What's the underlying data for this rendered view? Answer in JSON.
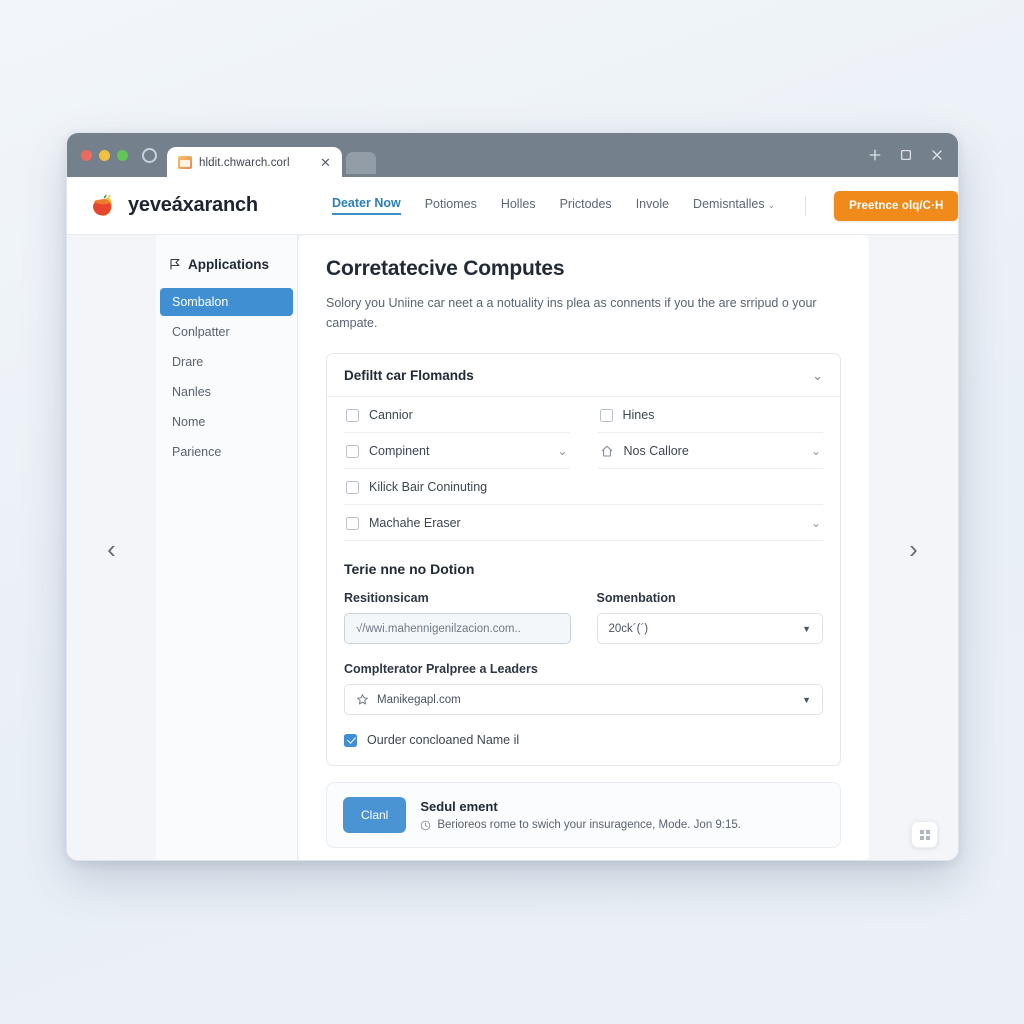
{
  "browser": {
    "tab": {
      "title": "hldit.chwarch.corl",
      "favicon": "site-favicon",
      "close": "✕"
    },
    "new_tab": "+",
    "window_controls": {
      "minimize": "+",
      "maximize": "□",
      "close": "✕"
    }
  },
  "header": {
    "brand": "yeveáxaranch",
    "logo": "fruit-logo",
    "nav": [
      {
        "label": "Deater Now",
        "active": true,
        "caret": ""
      },
      {
        "label": "Potiomes",
        "active": false,
        "caret": ""
      },
      {
        "label": "Holles",
        "active": false,
        "caret": ""
      },
      {
        "label": "Prictodes",
        "active": false,
        "caret": ""
      },
      {
        "label": "Invole",
        "active": false,
        "caret": ""
      },
      {
        "label": "Demisntalles",
        "active": false,
        "caret": "⌄"
      }
    ],
    "cta": "Preetnce olq/C·H"
  },
  "rails": {
    "prev": "‹",
    "next": "›"
  },
  "sidebar": {
    "heading": "Applications",
    "heading_icon": "flag-icon",
    "items": [
      {
        "label": "Sombalon",
        "active": true
      },
      {
        "label": "Conlpatter",
        "active": false
      },
      {
        "label": "Drare",
        "active": false
      },
      {
        "label": "Nanles",
        "active": false
      },
      {
        "label": "Nome",
        "active": false
      },
      {
        "label": "Parience",
        "active": false
      }
    ]
  },
  "main": {
    "title": "Corretatecive Computes",
    "description": "Solory you Uniine car neet a a notuality ins plea as connents if you the are srripud o your campate.",
    "panel": {
      "title": "Defiltt car Flomands",
      "collapse_caret": "⌄",
      "checkboxes": [
        {
          "label": "Cannior",
          "checked": false,
          "icon": "",
          "tail": "",
          "span": false
        },
        {
          "label": "Hines",
          "checked": false,
          "icon": "",
          "tail": "",
          "span": false
        },
        {
          "label": "Compinent",
          "checked": false,
          "icon": "",
          "tail": "⌄",
          "span": false
        },
        {
          "label": "Nos Callore",
          "checked": false,
          "icon": "home-icon",
          "tail": "⌄",
          "span": false
        },
        {
          "label": "Kilick Bair Coninuting",
          "checked": false,
          "icon": "",
          "tail": "",
          "span": true
        },
        {
          "label": "Machahe Eraser",
          "checked": false,
          "icon": "",
          "tail": "⌄",
          "span": true
        }
      ],
      "section_title": "Terie nne no Dotion",
      "fields": [
        {
          "label": "Resitionsicam",
          "value": "√/wwi.mahennigenilzacion.com..",
          "type": "input"
        },
        {
          "label": "Somenbation",
          "value": "20ck´(´)",
          "type": "select",
          "caret": "▼"
        }
      ],
      "wide_field": {
        "label": "Complterator Pralpree a Leaders",
        "value": "Manikegapl.com",
        "icon": "star-icon",
        "caret": "▼"
      },
      "last_checkbox": {
        "label": "Ourder concloaned Name il",
        "checked": true
      }
    }
  },
  "footer": {
    "button": "Clanl",
    "title": "Sedul ement",
    "subtitle": "Berioreos rome to swich your insuragence, Mode. Jon 9:15.",
    "icon": "clock-icon"
  },
  "fab": {
    "icon": "grid-icon"
  }
}
